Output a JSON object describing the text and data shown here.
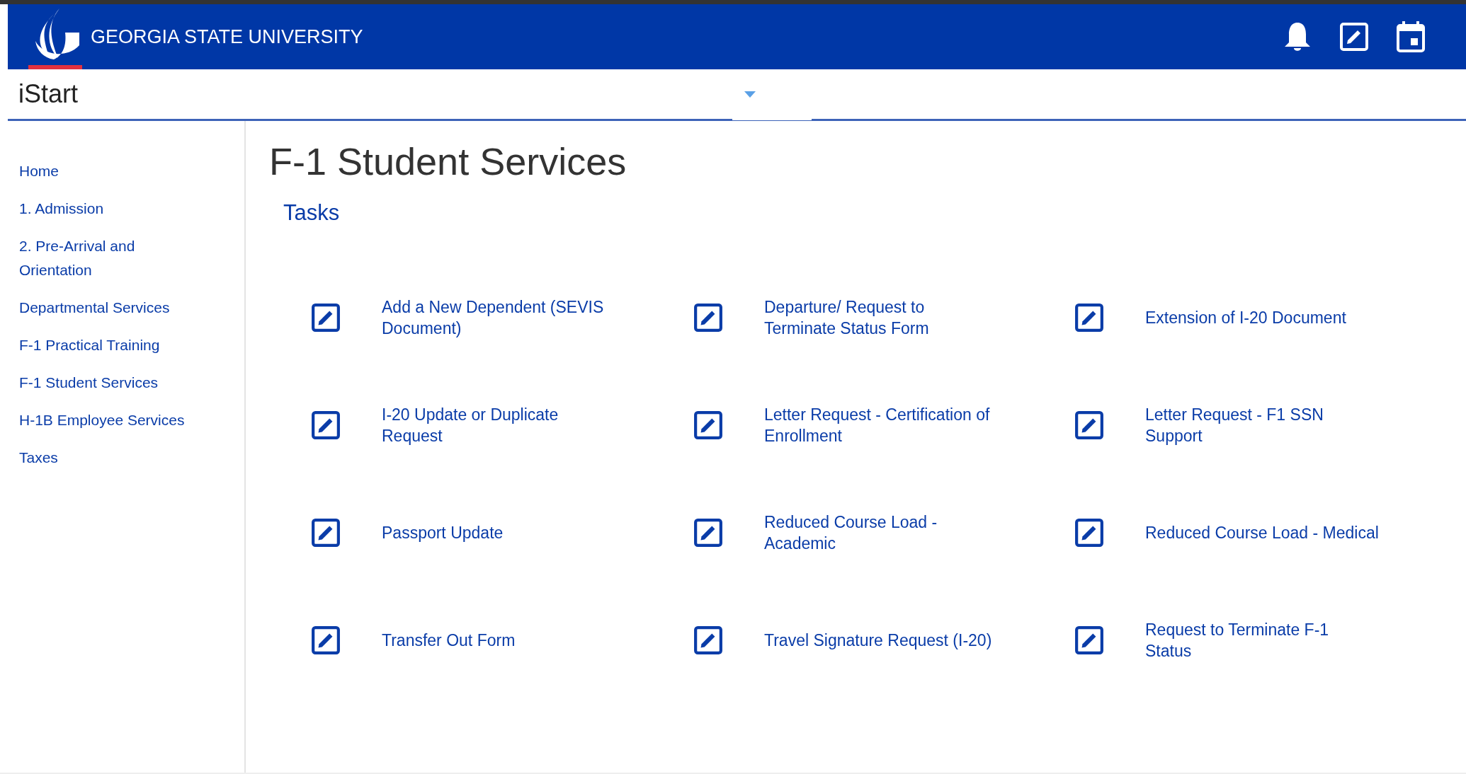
{
  "header": {
    "university": "GEORGIA STATE UNIVERSITY"
  },
  "app_bar": {
    "title": "iStart"
  },
  "sidebar": {
    "items": [
      {
        "label": "Home"
      },
      {
        "label": "1. Admission"
      },
      {
        "label": "2. Pre-Arrival and Orientation"
      },
      {
        "label": "Departmental Services"
      },
      {
        "label": "F-1 Practical Training"
      },
      {
        "label": "F-1 Student Services"
      },
      {
        "label": "H-1B Employee Services"
      },
      {
        "label": "Taxes"
      }
    ]
  },
  "page": {
    "title": "F-1 Student Services",
    "section": "Tasks"
  },
  "tasks": [
    {
      "label": "Add a New Dependent (SEVIS Document)"
    },
    {
      "label": "Departure/ Request to Terminate Status Form"
    },
    {
      "label": "Extension of I-20 Document"
    },
    {
      "label": "I-20 Update or Duplicate Request"
    },
    {
      "label": "Letter Request - Certification of Enrollment"
    },
    {
      "label": "Letter Request - F1 SSN Support"
    },
    {
      "label": "Passport Update"
    },
    {
      "label": "Reduced Course Load - Academic"
    },
    {
      "label": "Reduced Course Load - Medical"
    },
    {
      "label": "Transfer Out Form"
    },
    {
      "label": "Travel Signature Request (I-20)"
    },
    {
      "label": "Request to Terminate F-1 Status"
    }
  ]
}
